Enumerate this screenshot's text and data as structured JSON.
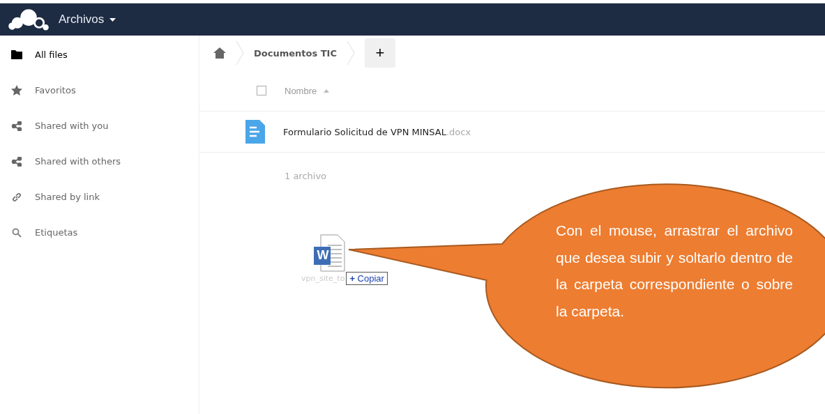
{
  "header": {
    "app_title": "Archivos"
  },
  "sidebar": {
    "items": [
      {
        "label": "All files",
        "kind": "folder",
        "selected": true
      },
      {
        "label": "Favoritos",
        "kind": "star",
        "selected": false
      },
      {
        "label": "Shared with you",
        "kind": "share",
        "selected": false
      },
      {
        "label": "Shared with others",
        "kind": "share",
        "selected": false
      },
      {
        "label": "Shared by link",
        "kind": "link",
        "selected": false
      },
      {
        "label": "Etiquetas",
        "kind": "search",
        "selected": false
      }
    ]
  },
  "breadcrumb": {
    "items": [
      "Documentos TIC"
    ],
    "new_button": "+"
  },
  "table": {
    "columns": [
      {
        "label": "Nombre",
        "checked": false
      }
    ],
    "rows": [
      {
        "name": "Formulario Solicitud de VPN MINSAL",
        "extension": ".docx"
      }
    ],
    "summary": "1 archivo"
  },
  "drag": {
    "icon_letter": "W",
    "file_name": "vpn_site_to",
    "action_icon": "+",
    "action": "Copiar"
  },
  "callout": {
    "text": "Con el mouse, arrastrar el archivo que desea subir y soltarlo dentro de la carpeta correspondiente o sobre la carpeta."
  }
}
